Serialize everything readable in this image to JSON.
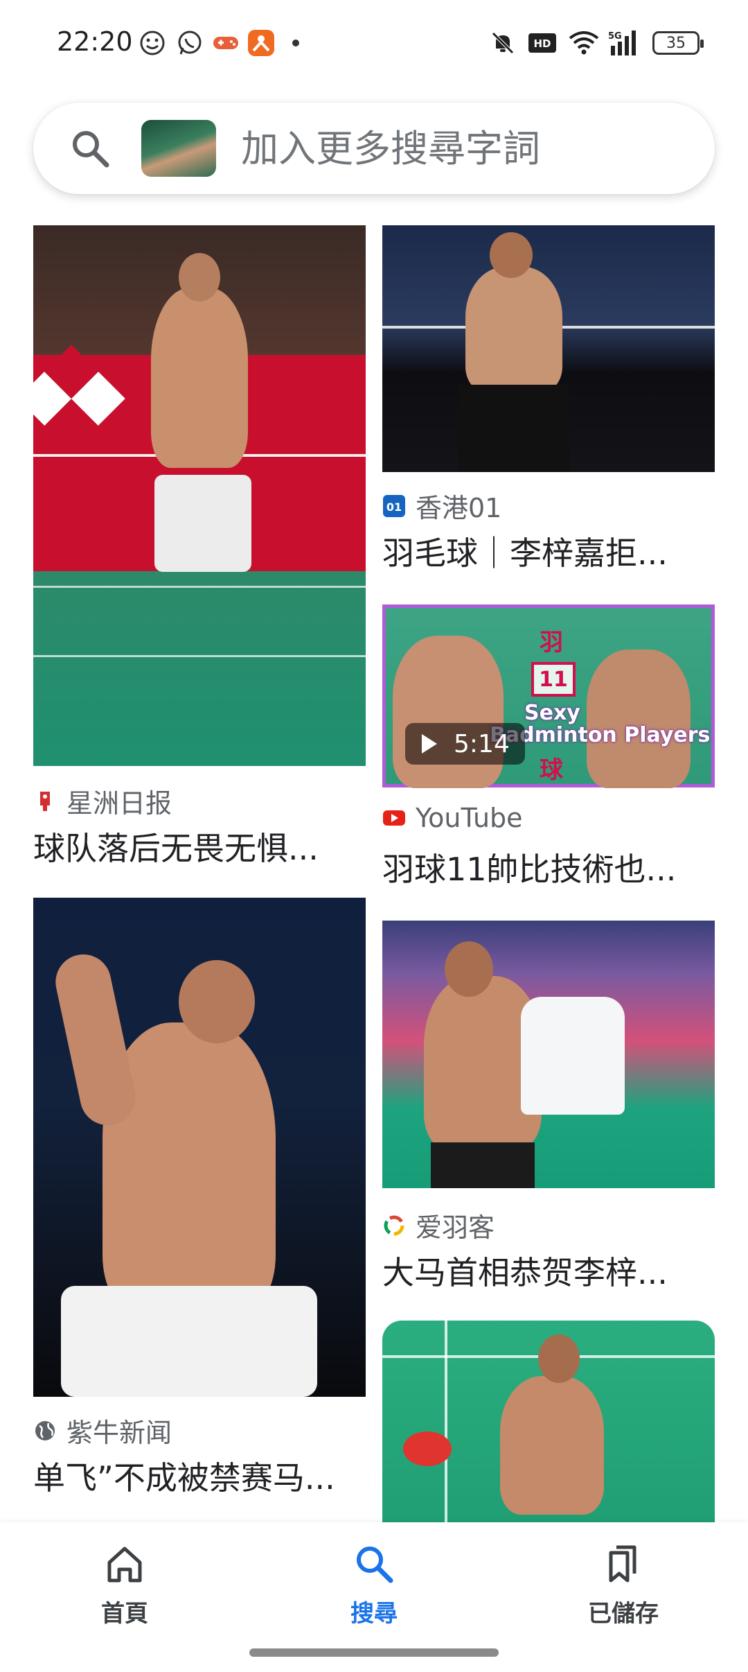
{
  "status_bar": {
    "time": "22:20",
    "battery": "35",
    "icons": [
      "smiley-icon",
      "whatsapp-icon",
      "game-icon",
      "app-icon",
      "dot-icon",
      "mute-icon",
      "hd-icon",
      "wifi-icon",
      "signal-5g-icon"
    ]
  },
  "search": {
    "placeholder": "加入更多搜尋字詞"
  },
  "results": [
    {
      "source": "星洲日报",
      "title": "球队落后无畏无惧..."
    },
    {
      "source": "香港01",
      "title": "羽毛球｜李梓嘉拒..."
    },
    {
      "source": "YouTube",
      "title": "羽球11帥比技術也...",
      "duration": "5:14",
      "overlay_cn_1": "羽",
      "overlay_number": "11",
      "overlay_text_1": "Sexy",
      "overlay_text_2": "Badminton Players",
      "overlay_cn_2": "球"
    },
    {
      "source": "紫牛新闻",
      "title": "单飞”不成被禁赛马..."
    },
    {
      "source": "爱羽客",
      "title": "大马首相恭贺李梓..."
    }
  ],
  "bottom_nav": {
    "home_label": "首頁",
    "search_label": "搜尋",
    "saved_label": "已儲存"
  },
  "colors": {
    "accent": "#1a73e8",
    "video_border": "#b05ad8"
  }
}
